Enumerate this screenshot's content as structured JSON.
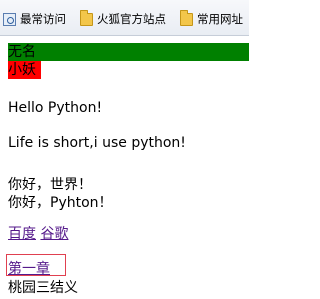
{
  "bookmarks_bar": {
    "items": [
      {
        "label": "最常访问",
        "icon": "page-gear-icon"
      },
      {
        "label": "火狐官方站点",
        "icon": "folder-icon"
      },
      {
        "label": "常用网址",
        "icon": "folder-icon"
      }
    ]
  },
  "content": {
    "green_bar_text": "无名",
    "red_bar_text": "小妖",
    "hello": "Hello Python!",
    "life": "Life is short,i use python!",
    "chinese_line1": "你好，世界！",
    "chinese_line2": "你好，Pyhton！",
    "links": [
      {
        "label": "百度"
      },
      {
        "label": "谷歌"
      }
    ],
    "chapter_link": "第一章",
    "chapter_text": "桃园三结义"
  },
  "colors": {
    "green_bar": "#008000",
    "red_bar": "#ff0000",
    "link": "#551a8b",
    "chapter_box_border": "#e04050"
  }
}
